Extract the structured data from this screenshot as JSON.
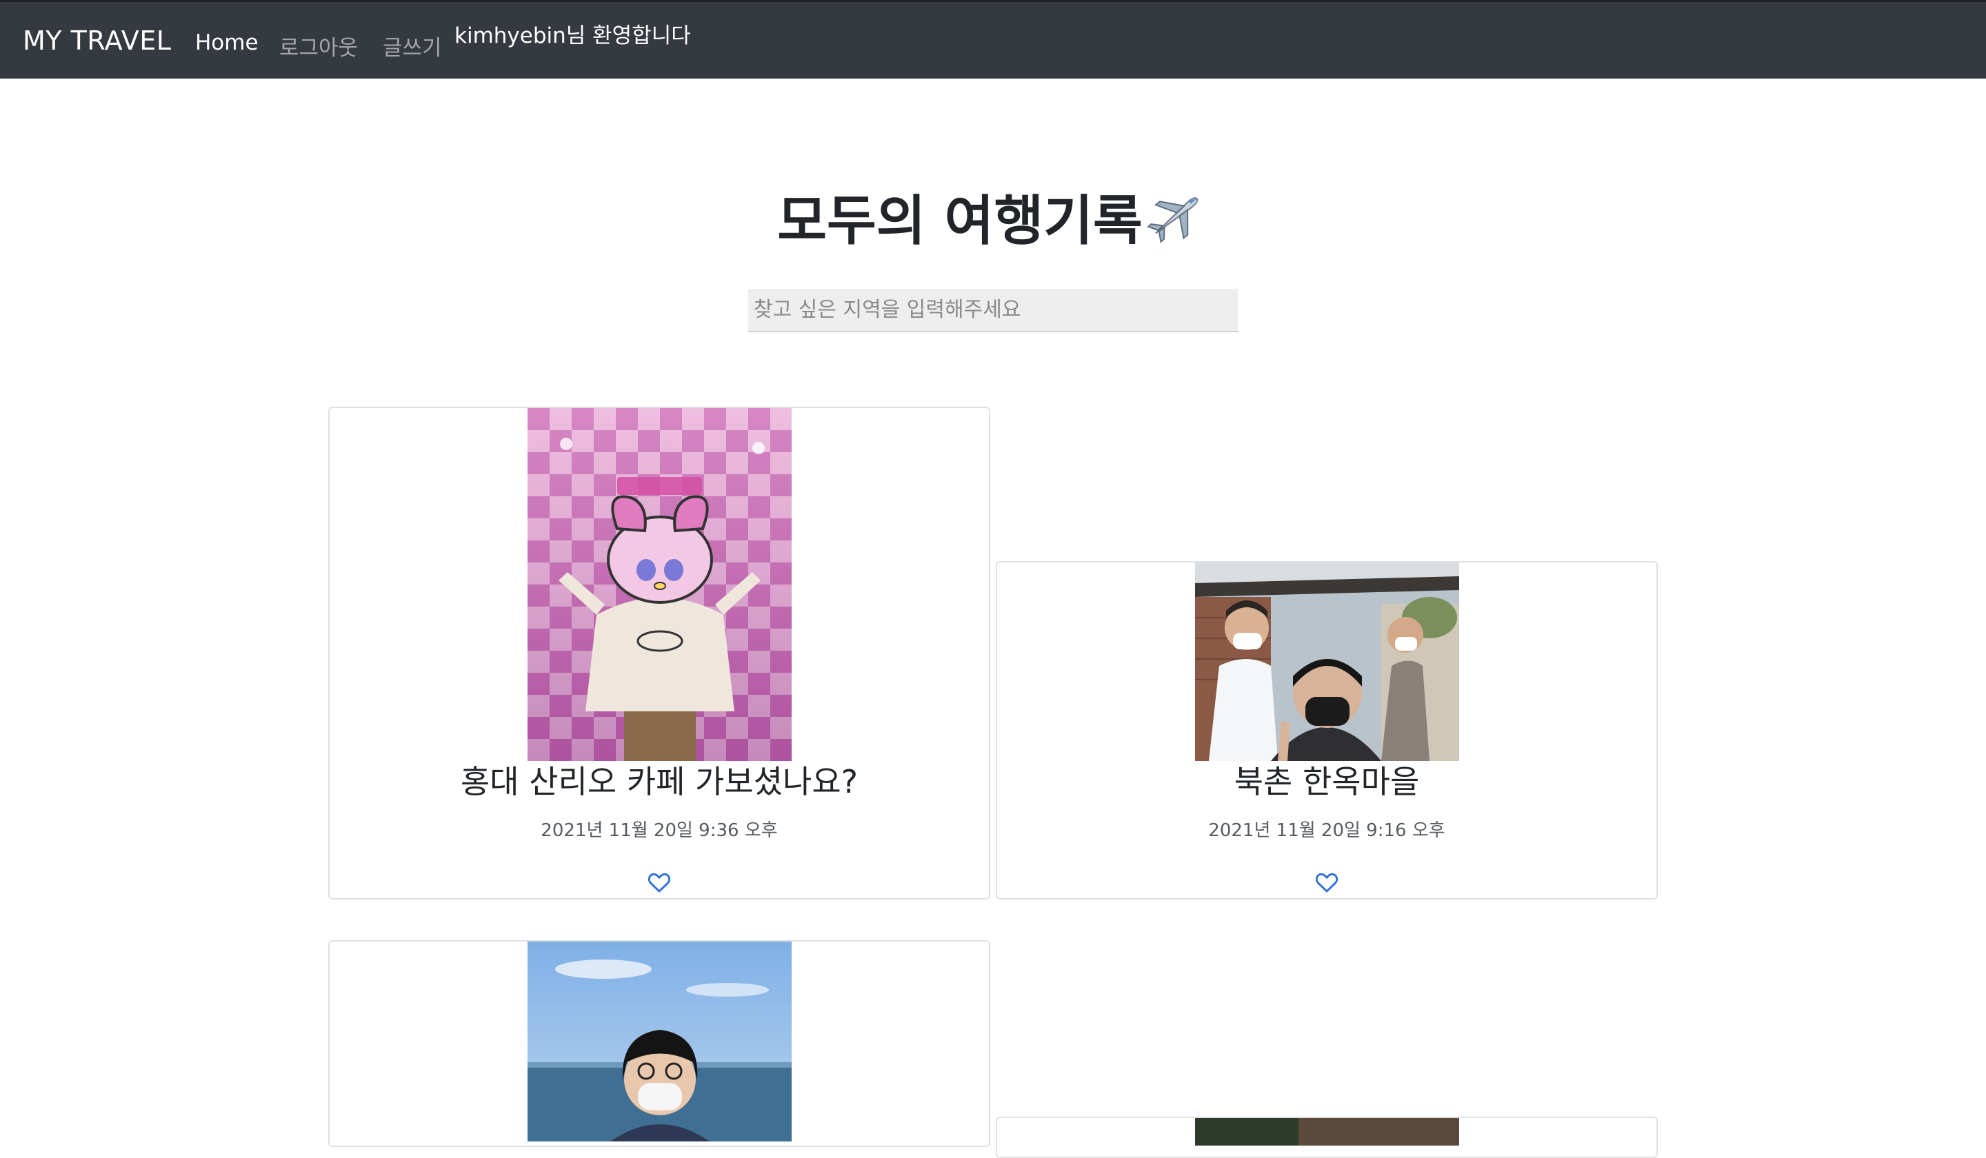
{
  "navbar": {
    "brand": "MY TRAVEL",
    "links": [
      "Home",
      "로그아웃",
      "글쓰기"
    ],
    "welcome": "kimhyebin님 환영합니다"
  },
  "header": {
    "title": "모두의 여행기록",
    "title_icon": "airplane-icon"
  },
  "search": {
    "placeholder": "찾고 싶은 지역을 입력해주세요",
    "value": ""
  },
  "posts": [
    {
      "title": "홍대 산리오 카페 가보셨나요?",
      "date": "2021년 11월 20일 9:36 오후",
      "liked": false
    },
    {
      "title": "북촌 한옥마을",
      "date": "2021년 11월 20일 9:16 오후",
      "liked": false
    }
  ],
  "colors": {
    "navbar_bg": "#343a40",
    "heart": "#2f6fd6",
    "search_bg": "#eeeeee"
  }
}
